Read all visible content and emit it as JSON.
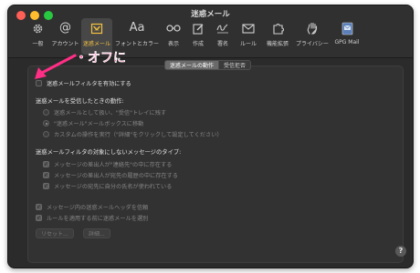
{
  "window": {
    "title": "迷惑メール"
  },
  "toolbar": {
    "items": [
      {
        "label": "一般",
        "icon": "gear-icon"
      },
      {
        "label": "アカウント",
        "icon": "at-sign-icon"
      },
      {
        "label": "迷惑メール",
        "icon": "junk-tray-icon",
        "active": true
      },
      {
        "label": "フォントとカラー",
        "icon": "font-icon"
      },
      {
        "label": "表示",
        "icon": "glasses-icon"
      },
      {
        "label": "作成",
        "icon": "compose-icon"
      },
      {
        "label": "署名",
        "icon": "signature-icon"
      },
      {
        "label": "ルール",
        "icon": "rules-envelope-icon"
      },
      {
        "label": "機能拡張",
        "icon": "puzzle-icon"
      },
      {
        "label": "プライバシー",
        "icon": "hand-icon"
      },
      {
        "label": "GPG Mail",
        "icon": "gpg-mail-icon"
      }
    ]
  },
  "tabs": [
    {
      "label": "迷惑メールの動作",
      "active": true
    },
    {
      "label": "受信拒否",
      "active": false
    }
  ],
  "annotation": {
    "text": "・オフに",
    "color": "#ff2e86"
  },
  "junk": {
    "enable_label": "迷惑メールフィルタを有効にする",
    "on_receive_heading": "迷惑メールを受信したときの動作:",
    "radio_options": [
      "迷惑メールとして扱い、\"受信\"トレイに残す",
      "\"迷惑メール\"メールボックスに移動",
      "カスタムの操作を実行（\"詳細\"をクリックして設定してください）"
    ],
    "exempt_heading": "迷惑メールフィルタの対象にしないメッセージのタイプ:",
    "exempt_options": [
      "メッセージの差出人が\"連絡先\"の中に存在する",
      "メッセージの差出人が宛先の履歴の中に存在する",
      "メッセージの宛先に自分の氏名が使われている"
    ],
    "bottom_options": [
      "メッセージ内の迷惑メールヘッダを信頼",
      "ルールを適用する前に迷惑メールを選別"
    ],
    "reset_button": "リセット...",
    "advanced_button": "詳細...",
    "help_button": "?"
  }
}
